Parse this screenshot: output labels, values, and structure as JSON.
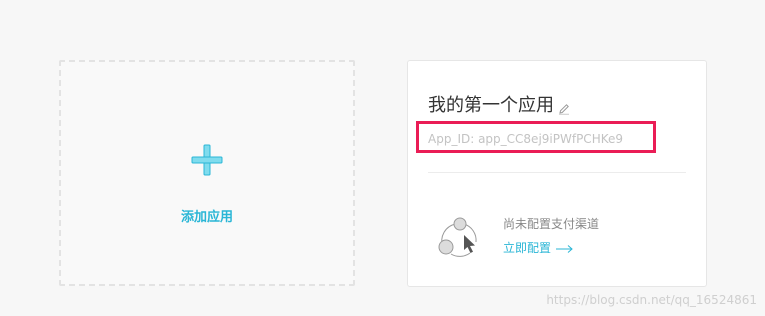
{
  "add_card": {
    "label": "添加应用",
    "icon": "plus-icon"
  },
  "app_card": {
    "name": "我的第一个应用",
    "app_id_text": "App_ID: app_CC8ej9iPWfPCHKe9",
    "channel_status": "尚未配置支付渠道",
    "configure_link": "立即配置",
    "highlight_color": "#ea1d56"
  },
  "colors": {
    "accent": "#2ab6d6"
  },
  "watermark": "https://blog.csdn.net/qq_16524861"
}
